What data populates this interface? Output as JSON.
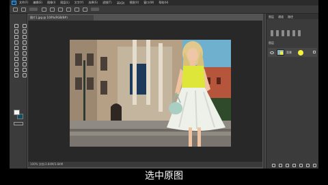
{
  "app": {
    "logo": "Ps",
    "menu": [
      "文件(F)",
      "编辑(E)",
      "图像(I)",
      "图层(L)",
      "文字(Y)",
      "选择(S)",
      "滤镜(T)",
      "3D(D)",
      "视图(V)",
      "窗口(W)",
      "帮助(H)"
    ]
  },
  "document": {
    "tab_title": "图片1.jpg @ 100%(RGB/8#)",
    "status": "100%     文档:3.84M/3.84M"
  },
  "layers": {
    "panel_tabs": [
      "图层",
      "通道",
      "路径"
    ],
    "title": "图层",
    "layer_name": "背景"
  },
  "colors": {
    "foreground": "#f5f5f5",
    "background": "#0f4f5e",
    "accent": "#31a8ff",
    "cursor": "#f4f23a"
  },
  "caption": "选中原图"
}
